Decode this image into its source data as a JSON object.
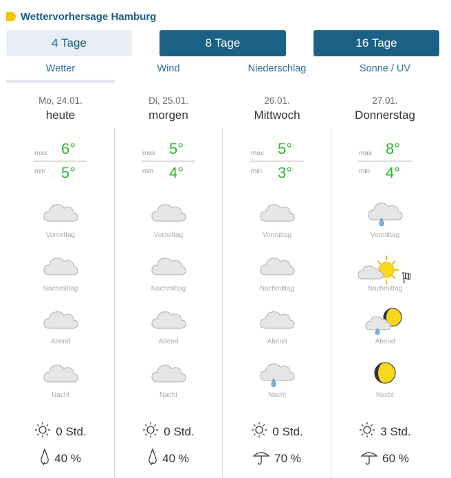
{
  "header": {
    "title": "Wettervorhersage Hamburg"
  },
  "range_buttons": [
    "4 Tage",
    "8 Tage",
    "16 Tage"
  ],
  "subtabs": [
    "Wetter",
    "Wind",
    "Niederschlag",
    "Sonne / UV"
  ],
  "labels": {
    "max": "max",
    "min": "min"
  },
  "periods": [
    "Vormittag",
    "Nachmittag",
    "Abend",
    "Nacht"
  ],
  "days": [
    {
      "date": "Mo, 24.01.",
      "name": "heute",
      "max": "6°",
      "min": "5°",
      "sun": "0 Std.",
      "rain": "40 %",
      "icons": [
        "cloud-icon",
        "cloud-icon",
        "cloud-icon",
        "cloud-icon"
      ],
      "rain_icon": "raindrop-icon"
    },
    {
      "date": "Di, 25.01.",
      "name": "morgen",
      "max": "5°",
      "min": "4°",
      "sun": "0 Std.",
      "rain": "40 %",
      "icons": [
        "cloud-icon",
        "cloud-icon",
        "cloud-icon",
        "cloud-icon"
      ],
      "rain_icon": "raindrop-icon"
    },
    {
      "date": "26.01.",
      "name": "Mittwoch",
      "max": "5°",
      "min": "3°",
      "sun": "0 Std.",
      "rain": "70 %",
      "icons": [
        "cloud-icon",
        "cloud-icon",
        "cloud-icon",
        "cloud-rain-icon"
      ],
      "rain_icon": "umbrella-icon"
    },
    {
      "date": "27.01.",
      "name": "Donnerstag",
      "max": "8°",
      "min": "4°",
      "sun": "3 Std.",
      "rain": "60 %",
      "icons": [
        "cloud-rain-icon",
        "sun-cloud-icon",
        "moon-cloud-rain-icon",
        "moon-icon"
      ],
      "rain_icon": "umbrella-icon"
    }
  ]
}
